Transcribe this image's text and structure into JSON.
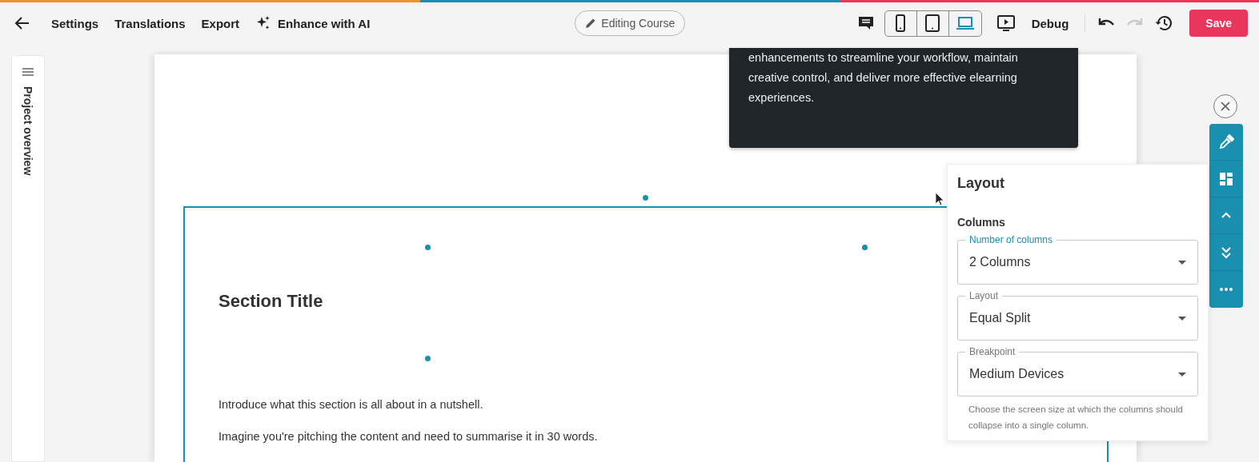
{
  "topbar": {
    "nav": [
      {
        "label": "Settings",
        "kind": "text"
      },
      {
        "label": "Translations",
        "kind": "text"
      },
      {
        "label": "Export",
        "kind": "text"
      },
      {
        "label": "Enhance with AI",
        "kind": "ai"
      }
    ],
    "status": "Editing Course",
    "devices": [
      {
        "kind": "phone",
        "selected": false
      },
      {
        "kind": "tablet",
        "selected": false
      },
      {
        "kind": "laptop",
        "selected": true
      }
    ],
    "debug": "Debug",
    "redo_disabled": true,
    "save": "Save"
  },
  "sidebar": {
    "label": "Project overview"
  },
  "canvas": {
    "card_text": "enhancements to streamline your workflow, maintain creative control, and deliver more effective elearning experiences.",
    "section_title": "Section Title",
    "paragraphs": [
      "Introduce what this section is all about in a nutshell.",
      "Imagine you're pitching the content and need to summarise it in 30 words."
    ]
  },
  "panel": {
    "title": "Layout",
    "heading": "Columns",
    "fields": [
      {
        "label": "Number of columns",
        "value": "2 Columns",
        "focused": true
      },
      {
        "label": "Layout",
        "value": "Equal Split",
        "focused": false
      },
      {
        "label": "Breakpoint",
        "value": "Medium Devices",
        "focused": false
      }
    ],
    "help": "Choose the screen size at which the columns should collapse into a single column."
  }
}
